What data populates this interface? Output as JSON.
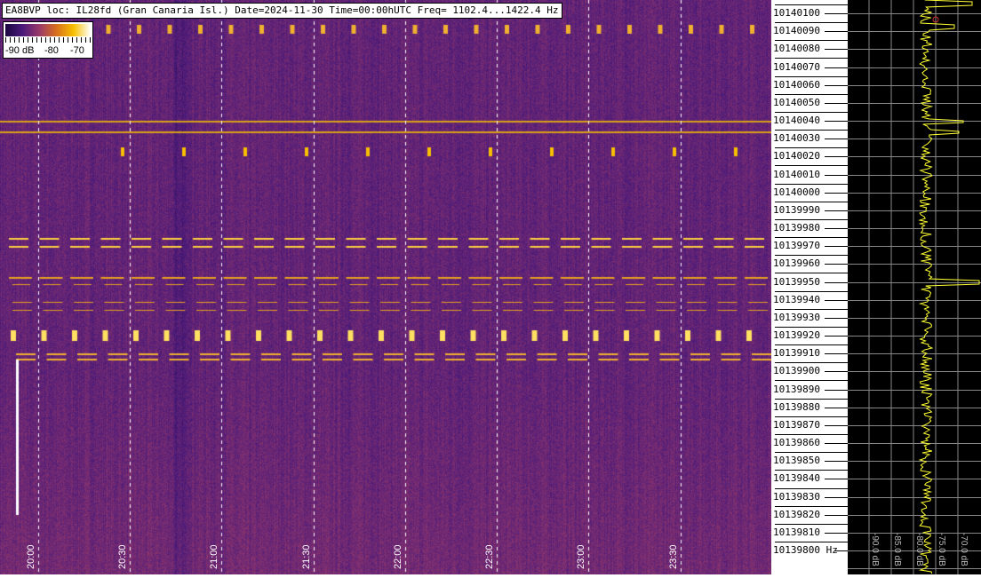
{
  "header": {
    "title": "EA8BVP loc: IL28fd (Gran Canaria Isl.) Date=2024-11-30 Time=00:00hUTC Freq= 1102.4...1422.4 Hz"
  },
  "legend": {
    "labels": [
      "-90 dB",
      "-80",
      "-70"
    ]
  },
  "chart_data": [
    {
      "type": "heatmap",
      "title": "EA8BVP loc: IL28fd (Gran Canaria Isl.) Date=2024-11-30 Time=00:00hUTC Freq= 1102.4...1422.4 Hz",
      "x_ticks": [
        "20:00",
        "20:30",
        "21:00",
        "21:30",
        "22:00",
        "22:30",
        "23:00",
        "23:30"
      ],
      "y_ticks": [
        "10140100",
        "10140090",
        "10140080",
        "10140070",
        "10140060",
        "10140050",
        "10140040",
        "10140030",
        "10140020",
        "10140010",
        "10140000",
        "10139990",
        "10139980",
        "10139970",
        "10139960",
        "10139950",
        "10139940",
        "10139930",
        "10139920",
        "10139910",
        "10139900",
        "10139890",
        "10139880",
        "10139870",
        "10139860",
        "10139850",
        "10139840",
        "10139830",
        "10139820",
        "10139810",
        "10139800"
      ],
      "y_unit": "Hz",
      "colorscale": {
        "min": -90,
        "max": -70,
        "unit": "dB",
        "colors": [
          "#1a0640",
          "#4a1a7a",
          "#9a3a6a",
          "#d8701e",
          "#f8c000",
          "#ffffff"
        ]
      },
      "grid": true
    },
    {
      "type": "line",
      "x_ticks": [
        "-90.0 dB",
        "-85.0 dB",
        "-80.0 dB",
        "-75.0 dB",
        "-70.0 dB"
      ],
      "xlim": [
        -90,
        -70
      ],
      "line_color": "#ffff33",
      "background": "#000000",
      "grid": true
    }
  ]
}
